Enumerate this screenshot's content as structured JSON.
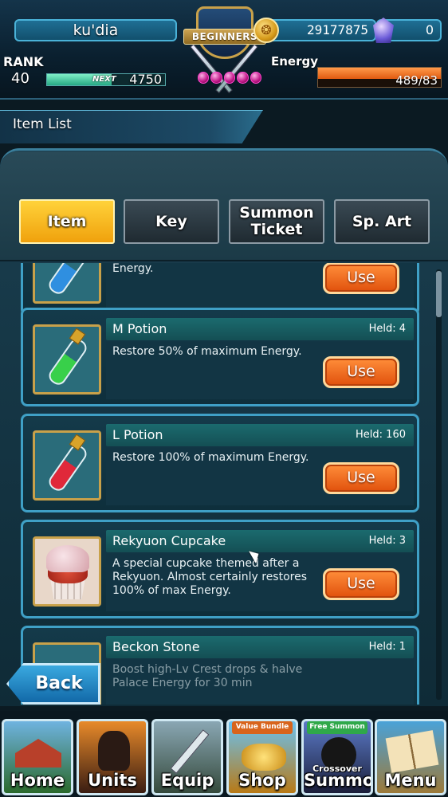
{
  "hud": {
    "player_name": "ku'dia",
    "gold": "29177875",
    "gems": "0",
    "emblem_text": "BEGINNERS",
    "rank_label": "RANK",
    "rank": "40",
    "next_label": "NEXT",
    "next_exp": "4750",
    "exp_progress": 0.55,
    "energy_label": "Energy",
    "energy": "489/83",
    "energy_progress": 1.0,
    "colors": {
      "exp": "#26a884",
      "energy": "#e05a10",
      "accent": "#3fa0c6"
    }
  },
  "section": {
    "title": "Item List"
  },
  "tabs": [
    {
      "label": "Item",
      "active": true
    },
    {
      "label": "Key",
      "active": false
    },
    {
      "label": "Summon Ticket",
      "active": false
    },
    {
      "label": "Sp. Art",
      "active": false
    }
  ],
  "items": [
    {
      "name": "",
      "held": "",
      "desc": "Energy.",
      "use": "Use",
      "icon": "potion-icon"
    },
    {
      "name": "M Potion",
      "held": "Held: 4",
      "desc": "Restore 50% of maximum Energy.",
      "use": "Use",
      "icon": "green-potion-icon"
    },
    {
      "name": "L Potion",
      "held": "Held: 160",
      "desc": "Restore 100% of maximum Energy.",
      "use": "Use",
      "icon": "red-potion-icon"
    },
    {
      "name": "Rekyuon Cupcake",
      "held": "Held: 3",
      "desc": "A special cupcake themed after a Rekyuon. Almost certainly restores 100% of max Energy.",
      "use": "Use",
      "icon": "cupcake-icon"
    },
    {
      "name": "Beckon Stone",
      "held": "Held: 1",
      "desc": "Boost high-Lv Crest drops & halve Palace Energy for 30 min",
      "use": "",
      "icon": "beckon-stone-icon"
    }
  ],
  "back_label": "Back",
  "nav": {
    "home": "Home",
    "units": "Units",
    "equip": "Equip",
    "shop": "Shop",
    "shop_badge": "Value Bundle",
    "summon": "Summon",
    "summon_badge": "Free Summon",
    "summon_sub": "Crossover",
    "menu": "Menu"
  }
}
